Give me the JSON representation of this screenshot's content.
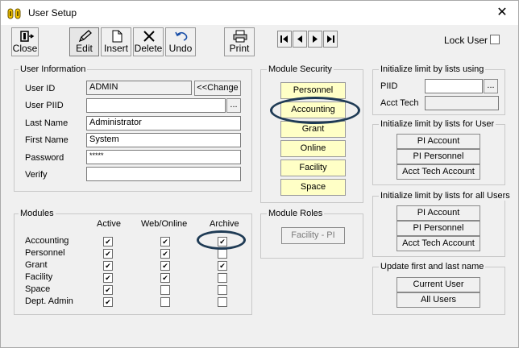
{
  "window": {
    "title": "User Setup"
  },
  "toolbar": {
    "close": "Close",
    "edit": "Edit",
    "insert": "Insert",
    "delete": "Delete",
    "undo": "Undo",
    "print": "Print"
  },
  "lock_user": {
    "label": "Lock User",
    "checked": false
  },
  "user_info": {
    "group_label": "User Information",
    "user_id_label": "User ID",
    "user_id": "ADMIN",
    "change_button": "<<Change",
    "user_piid_label": "User PIID",
    "user_piid": "",
    "piid_browse": "...",
    "last_name_label": "Last Name",
    "last_name": "Administrator",
    "first_name_label": "First Name",
    "first_name": "System",
    "password_label": "Password",
    "password": "*****",
    "verify_label": "Verify",
    "verify": ""
  },
  "modules": {
    "group_label": "Modules",
    "col_active": "Active",
    "col_web": "Web/Online",
    "col_archive": "Archive",
    "rows": [
      {
        "name": "Accounting",
        "active": true,
        "web": true,
        "archive": true
      },
      {
        "name": "Personnel",
        "active": true,
        "web": true,
        "archive": false
      },
      {
        "name": "Grant",
        "active": true,
        "web": true,
        "archive": true
      },
      {
        "name": "Facility",
        "active": true,
        "web": true,
        "archive": false
      },
      {
        "name": "Space",
        "active": true,
        "web": false,
        "archive": false
      },
      {
        "name": "Dept. Admin",
        "active": true,
        "web": false,
        "archive": false
      }
    ]
  },
  "module_security": {
    "group_label": "Module Security",
    "buttons": [
      "Personnel",
      "Accounting",
      "Grant",
      "Online",
      "Facility",
      "Space"
    ],
    "button_color": "#ffffc6"
  },
  "module_roles": {
    "group_label": "Module Roles",
    "facility_pi": "Facility - PI"
  },
  "init_lists": {
    "group_label": "Initialize limit by lists using",
    "piid_label": "PIID",
    "piid": "",
    "piid_browse": "...",
    "acct_tech_label": "Acct Tech",
    "acct_tech": ""
  },
  "init_user": {
    "group_label": "Initialize limit by lists for User",
    "pi_account": "PI Account",
    "pi_personnel": "PI Personnel",
    "acct_tech_account": "Acct Tech Account"
  },
  "init_all": {
    "group_label": "Initialize limit by lists for all Users",
    "pi_account": "PI Account",
    "pi_personnel": "PI Personnel",
    "acct_tech_account": "Acct Tech Account"
  },
  "update_names": {
    "group_label": "Update first and last name",
    "current_user": "Current User",
    "all_users": "All Users"
  },
  "annotation_color": "#1f3b55"
}
